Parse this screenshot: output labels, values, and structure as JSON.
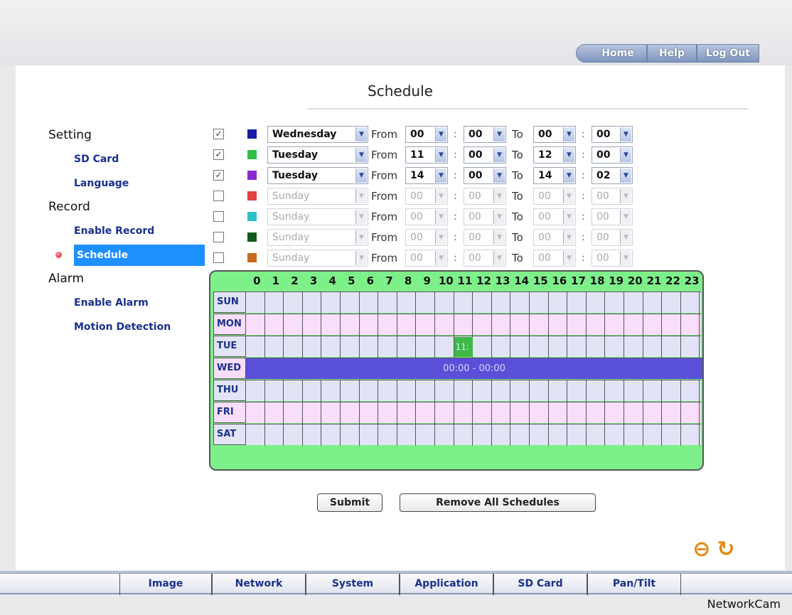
{
  "topnav": {
    "home": "Home",
    "help": "Help",
    "logout": "Log Out"
  },
  "page": {
    "title": "Schedule"
  },
  "sidebar": {
    "setting": "Setting",
    "sd_card": "SD Card",
    "language": "Language",
    "record": "Record",
    "enable_record": "Enable Record",
    "schedule": "Schedule",
    "alarm": "Alarm",
    "enable_alarm": "Enable Alarm",
    "motion_detection": "Motion Detection"
  },
  "labels": {
    "from": "From",
    "to": "To",
    "colon": ":"
  },
  "schedules": [
    {
      "checked": true,
      "color": "#1a1aa6",
      "day": "Wednesday",
      "from_h": "00",
      "from_m": "00",
      "to_h": "00",
      "to_m": "00"
    },
    {
      "checked": true,
      "color": "#2fbf4a",
      "day": "Tuesday",
      "from_h": "11",
      "from_m": "00",
      "to_h": "12",
      "to_m": "00"
    },
    {
      "checked": true,
      "color": "#8a2ad0",
      "day": "Tuesday",
      "from_h": "14",
      "from_m": "00",
      "to_h": "14",
      "to_m": "02"
    },
    {
      "checked": false,
      "color": "#e24242",
      "day": "Sunday",
      "from_h": "00",
      "from_m": "00",
      "to_h": "00",
      "to_m": "00"
    },
    {
      "checked": false,
      "color": "#2bc0c8",
      "day": "Sunday",
      "from_h": "00",
      "from_m": "00",
      "to_h": "00",
      "to_m": "00"
    },
    {
      "checked": false,
      "color": "#0f5a1a",
      "day": "Sunday",
      "from_h": "00",
      "from_m": "00",
      "to_h": "00",
      "to_m": "00"
    },
    {
      "checked": false,
      "color": "#c76a1d",
      "day": "Sunday",
      "from_h": "00",
      "from_m": "00",
      "to_h": "00",
      "to_m": "00"
    }
  ],
  "grid": {
    "hours": [
      "0",
      "1",
      "2",
      "3",
      "4",
      "5",
      "6",
      "7",
      "8",
      "9",
      "10",
      "11",
      "12",
      "13",
      "14",
      "15",
      "16",
      "17",
      "18",
      "19",
      "20",
      "21",
      "22",
      "23"
    ],
    "days": [
      "SUN",
      "MON",
      "TUE",
      "WED",
      "THU",
      "FRI",
      "SAT"
    ],
    "wed_bar_label": "00:00 - 00:00",
    "tue_mark_label": "11:",
    "colors": {
      "lavender": "#e2e4f6",
      "pink": "#f8defa",
      "wed_bar": "#5a4fd8",
      "tue_mark": "#3fb84a"
    }
  },
  "buttons": {
    "submit": "Submit",
    "remove_all": "Remove All Schedules"
  },
  "bottom_tabs": [
    "Image",
    "Network",
    "System",
    "Application",
    "SD Card",
    "Pan/Tilt"
  ],
  "brand": "NetworkCam"
}
